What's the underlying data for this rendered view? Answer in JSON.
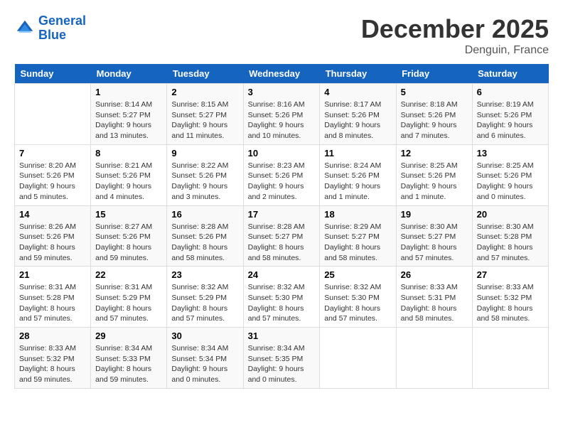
{
  "header": {
    "logo_line1": "General",
    "logo_line2": "Blue",
    "month": "December 2025",
    "location": "Denguin, France"
  },
  "weekdays": [
    "Sunday",
    "Monday",
    "Tuesday",
    "Wednesday",
    "Thursday",
    "Friday",
    "Saturday"
  ],
  "weeks": [
    [
      {
        "day": "",
        "info": ""
      },
      {
        "day": "1",
        "info": "Sunrise: 8:14 AM\nSunset: 5:27 PM\nDaylight: 9 hours\nand 13 minutes."
      },
      {
        "day": "2",
        "info": "Sunrise: 8:15 AM\nSunset: 5:27 PM\nDaylight: 9 hours\nand 11 minutes."
      },
      {
        "day": "3",
        "info": "Sunrise: 8:16 AM\nSunset: 5:26 PM\nDaylight: 9 hours\nand 10 minutes."
      },
      {
        "day": "4",
        "info": "Sunrise: 8:17 AM\nSunset: 5:26 PM\nDaylight: 9 hours\nand 8 minutes."
      },
      {
        "day": "5",
        "info": "Sunrise: 8:18 AM\nSunset: 5:26 PM\nDaylight: 9 hours\nand 7 minutes."
      },
      {
        "day": "6",
        "info": "Sunrise: 8:19 AM\nSunset: 5:26 PM\nDaylight: 9 hours\nand 6 minutes."
      }
    ],
    [
      {
        "day": "7",
        "info": "Sunrise: 8:20 AM\nSunset: 5:26 PM\nDaylight: 9 hours\nand 5 minutes."
      },
      {
        "day": "8",
        "info": "Sunrise: 8:21 AM\nSunset: 5:26 PM\nDaylight: 9 hours\nand 4 minutes."
      },
      {
        "day": "9",
        "info": "Sunrise: 8:22 AM\nSunset: 5:26 PM\nDaylight: 9 hours\nand 3 minutes."
      },
      {
        "day": "10",
        "info": "Sunrise: 8:23 AM\nSunset: 5:26 PM\nDaylight: 9 hours\nand 2 minutes."
      },
      {
        "day": "11",
        "info": "Sunrise: 8:24 AM\nSunset: 5:26 PM\nDaylight: 9 hours\nand 1 minute."
      },
      {
        "day": "12",
        "info": "Sunrise: 8:25 AM\nSunset: 5:26 PM\nDaylight: 9 hours\nand 1 minute."
      },
      {
        "day": "13",
        "info": "Sunrise: 8:25 AM\nSunset: 5:26 PM\nDaylight: 9 hours\nand 0 minutes."
      }
    ],
    [
      {
        "day": "14",
        "info": "Sunrise: 8:26 AM\nSunset: 5:26 PM\nDaylight: 8 hours\nand 59 minutes."
      },
      {
        "day": "15",
        "info": "Sunrise: 8:27 AM\nSunset: 5:26 PM\nDaylight: 8 hours\nand 59 minutes."
      },
      {
        "day": "16",
        "info": "Sunrise: 8:28 AM\nSunset: 5:26 PM\nDaylight: 8 hours\nand 58 minutes."
      },
      {
        "day": "17",
        "info": "Sunrise: 8:28 AM\nSunset: 5:27 PM\nDaylight: 8 hours\nand 58 minutes."
      },
      {
        "day": "18",
        "info": "Sunrise: 8:29 AM\nSunset: 5:27 PM\nDaylight: 8 hours\nand 58 minutes."
      },
      {
        "day": "19",
        "info": "Sunrise: 8:30 AM\nSunset: 5:27 PM\nDaylight: 8 hours\nand 57 minutes."
      },
      {
        "day": "20",
        "info": "Sunrise: 8:30 AM\nSunset: 5:28 PM\nDaylight: 8 hours\nand 57 minutes."
      }
    ],
    [
      {
        "day": "21",
        "info": "Sunrise: 8:31 AM\nSunset: 5:28 PM\nDaylight: 8 hours\nand 57 minutes."
      },
      {
        "day": "22",
        "info": "Sunrise: 8:31 AM\nSunset: 5:29 PM\nDaylight: 8 hours\nand 57 minutes."
      },
      {
        "day": "23",
        "info": "Sunrise: 8:32 AM\nSunset: 5:29 PM\nDaylight: 8 hours\nand 57 minutes."
      },
      {
        "day": "24",
        "info": "Sunrise: 8:32 AM\nSunset: 5:30 PM\nDaylight: 8 hours\nand 57 minutes."
      },
      {
        "day": "25",
        "info": "Sunrise: 8:32 AM\nSunset: 5:30 PM\nDaylight: 8 hours\nand 57 minutes."
      },
      {
        "day": "26",
        "info": "Sunrise: 8:33 AM\nSunset: 5:31 PM\nDaylight: 8 hours\nand 58 minutes."
      },
      {
        "day": "27",
        "info": "Sunrise: 8:33 AM\nSunset: 5:32 PM\nDaylight: 8 hours\nand 58 minutes."
      }
    ],
    [
      {
        "day": "28",
        "info": "Sunrise: 8:33 AM\nSunset: 5:32 PM\nDaylight: 8 hours\nand 59 minutes."
      },
      {
        "day": "29",
        "info": "Sunrise: 8:34 AM\nSunset: 5:33 PM\nDaylight: 8 hours\nand 59 minutes."
      },
      {
        "day": "30",
        "info": "Sunrise: 8:34 AM\nSunset: 5:34 PM\nDaylight: 9 hours\nand 0 minutes."
      },
      {
        "day": "31",
        "info": "Sunrise: 8:34 AM\nSunset: 5:35 PM\nDaylight: 9 hours\nand 0 minutes."
      },
      {
        "day": "",
        "info": ""
      },
      {
        "day": "",
        "info": ""
      },
      {
        "day": "",
        "info": ""
      }
    ]
  ]
}
